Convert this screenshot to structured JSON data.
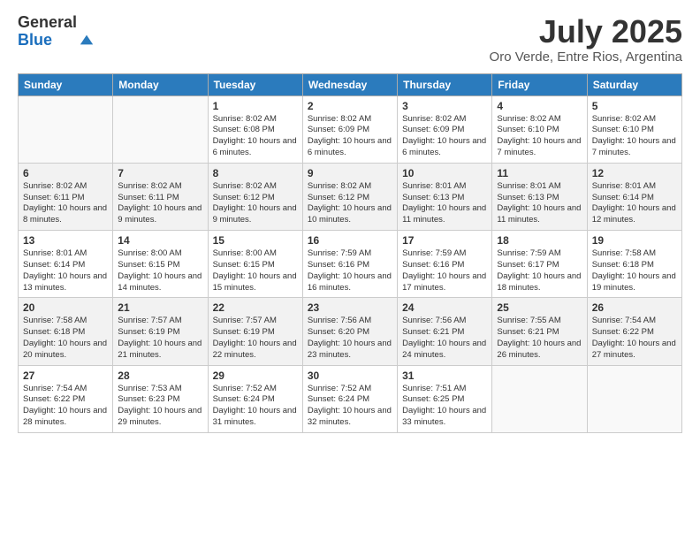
{
  "header": {
    "logo_general": "General",
    "logo_blue": "Blue",
    "title": "July 2025",
    "subtitle": "Oro Verde, Entre Rios, Argentina"
  },
  "days_of_week": [
    "Sunday",
    "Monday",
    "Tuesday",
    "Wednesday",
    "Thursday",
    "Friday",
    "Saturday"
  ],
  "weeks": [
    {
      "shaded": false,
      "days": [
        {
          "num": "",
          "info": ""
        },
        {
          "num": "",
          "info": ""
        },
        {
          "num": "1",
          "info": "Sunrise: 8:02 AM\nSunset: 6:08 PM\nDaylight: 10 hours and 6 minutes."
        },
        {
          "num": "2",
          "info": "Sunrise: 8:02 AM\nSunset: 6:09 PM\nDaylight: 10 hours and 6 minutes."
        },
        {
          "num": "3",
          "info": "Sunrise: 8:02 AM\nSunset: 6:09 PM\nDaylight: 10 hours and 6 minutes."
        },
        {
          "num": "4",
          "info": "Sunrise: 8:02 AM\nSunset: 6:10 PM\nDaylight: 10 hours and 7 minutes."
        },
        {
          "num": "5",
          "info": "Sunrise: 8:02 AM\nSunset: 6:10 PM\nDaylight: 10 hours and 7 minutes."
        }
      ]
    },
    {
      "shaded": true,
      "days": [
        {
          "num": "6",
          "info": "Sunrise: 8:02 AM\nSunset: 6:11 PM\nDaylight: 10 hours and 8 minutes."
        },
        {
          "num": "7",
          "info": "Sunrise: 8:02 AM\nSunset: 6:11 PM\nDaylight: 10 hours and 9 minutes."
        },
        {
          "num": "8",
          "info": "Sunrise: 8:02 AM\nSunset: 6:12 PM\nDaylight: 10 hours and 9 minutes."
        },
        {
          "num": "9",
          "info": "Sunrise: 8:02 AM\nSunset: 6:12 PM\nDaylight: 10 hours and 10 minutes."
        },
        {
          "num": "10",
          "info": "Sunrise: 8:01 AM\nSunset: 6:13 PM\nDaylight: 10 hours and 11 minutes."
        },
        {
          "num": "11",
          "info": "Sunrise: 8:01 AM\nSunset: 6:13 PM\nDaylight: 10 hours and 11 minutes."
        },
        {
          "num": "12",
          "info": "Sunrise: 8:01 AM\nSunset: 6:14 PM\nDaylight: 10 hours and 12 minutes."
        }
      ]
    },
    {
      "shaded": false,
      "days": [
        {
          "num": "13",
          "info": "Sunrise: 8:01 AM\nSunset: 6:14 PM\nDaylight: 10 hours and 13 minutes."
        },
        {
          "num": "14",
          "info": "Sunrise: 8:00 AM\nSunset: 6:15 PM\nDaylight: 10 hours and 14 minutes."
        },
        {
          "num": "15",
          "info": "Sunrise: 8:00 AM\nSunset: 6:15 PM\nDaylight: 10 hours and 15 minutes."
        },
        {
          "num": "16",
          "info": "Sunrise: 7:59 AM\nSunset: 6:16 PM\nDaylight: 10 hours and 16 minutes."
        },
        {
          "num": "17",
          "info": "Sunrise: 7:59 AM\nSunset: 6:16 PM\nDaylight: 10 hours and 17 minutes."
        },
        {
          "num": "18",
          "info": "Sunrise: 7:59 AM\nSunset: 6:17 PM\nDaylight: 10 hours and 18 minutes."
        },
        {
          "num": "19",
          "info": "Sunrise: 7:58 AM\nSunset: 6:18 PM\nDaylight: 10 hours and 19 minutes."
        }
      ]
    },
    {
      "shaded": true,
      "days": [
        {
          "num": "20",
          "info": "Sunrise: 7:58 AM\nSunset: 6:18 PM\nDaylight: 10 hours and 20 minutes."
        },
        {
          "num": "21",
          "info": "Sunrise: 7:57 AM\nSunset: 6:19 PM\nDaylight: 10 hours and 21 minutes."
        },
        {
          "num": "22",
          "info": "Sunrise: 7:57 AM\nSunset: 6:19 PM\nDaylight: 10 hours and 22 minutes."
        },
        {
          "num": "23",
          "info": "Sunrise: 7:56 AM\nSunset: 6:20 PM\nDaylight: 10 hours and 23 minutes."
        },
        {
          "num": "24",
          "info": "Sunrise: 7:56 AM\nSunset: 6:21 PM\nDaylight: 10 hours and 24 minutes."
        },
        {
          "num": "25",
          "info": "Sunrise: 7:55 AM\nSunset: 6:21 PM\nDaylight: 10 hours and 26 minutes."
        },
        {
          "num": "26",
          "info": "Sunrise: 7:54 AM\nSunset: 6:22 PM\nDaylight: 10 hours and 27 minutes."
        }
      ]
    },
    {
      "shaded": false,
      "days": [
        {
          "num": "27",
          "info": "Sunrise: 7:54 AM\nSunset: 6:22 PM\nDaylight: 10 hours and 28 minutes."
        },
        {
          "num": "28",
          "info": "Sunrise: 7:53 AM\nSunset: 6:23 PM\nDaylight: 10 hours and 29 minutes."
        },
        {
          "num": "29",
          "info": "Sunrise: 7:52 AM\nSunset: 6:24 PM\nDaylight: 10 hours and 31 minutes."
        },
        {
          "num": "30",
          "info": "Sunrise: 7:52 AM\nSunset: 6:24 PM\nDaylight: 10 hours and 32 minutes."
        },
        {
          "num": "31",
          "info": "Sunrise: 7:51 AM\nSunset: 6:25 PM\nDaylight: 10 hours and 33 minutes."
        },
        {
          "num": "",
          "info": ""
        },
        {
          "num": "",
          "info": ""
        }
      ]
    }
  ]
}
